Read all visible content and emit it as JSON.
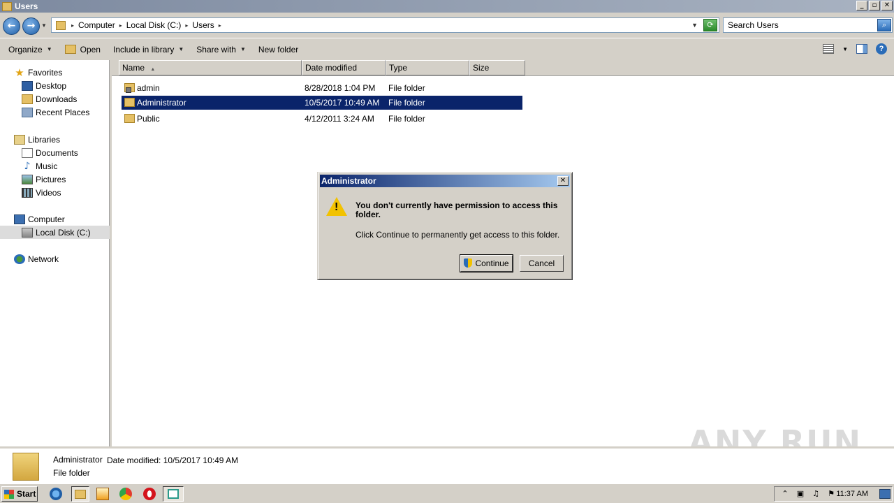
{
  "window": {
    "title": "Users"
  },
  "address": {
    "breadcrumbs": [
      "Computer",
      "Local Disk (C:)",
      "Users"
    ],
    "search_placeholder": "Search Users"
  },
  "toolbar": {
    "organize": "Organize",
    "open": "Open",
    "include_in_library": "Include in library",
    "share_with": "Share with",
    "new_folder": "New folder"
  },
  "nav": {
    "favorites": "Favorites",
    "desktop": "Desktop",
    "downloads": "Downloads",
    "recent_places": "Recent Places",
    "libraries": "Libraries",
    "documents": "Documents",
    "music": "Music",
    "pictures": "Pictures",
    "videos": "Videos",
    "computer": "Computer",
    "local_disk": "Local Disk (C:)",
    "network": "Network"
  },
  "columns": {
    "name": "Name",
    "date_modified": "Date modified",
    "type": "Type",
    "size": "Size"
  },
  "files": [
    {
      "name": "admin",
      "date": "8/28/2018 1:04 PM",
      "type": "File folder",
      "locked": true
    },
    {
      "name": "Administrator",
      "date": "10/5/2017 10:49 AM",
      "type": "File folder",
      "selected": true
    },
    {
      "name": "Public",
      "date": "4/12/2011 3:24 AM",
      "type": "File folder"
    }
  ],
  "dialog": {
    "title": "Administrator",
    "message": "You don't currently have permission to access this folder.",
    "submessage": "Click Continue to permanently get access to this folder.",
    "continue_label": "Continue",
    "cancel_label": "Cancel"
  },
  "details": {
    "name": "Administrator",
    "date_modified": "Date modified: 10/5/2017 10:49 AM",
    "type": "File folder"
  },
  "watermark": "ANY RUN",
  "taskbar": {
    "start_label": "Start",
    "clock": "11:37 AM"
  },
  "colors": {
    "selection": "#0a246a",
    "dialog_title_start": "#0a246a",
    "dialog_title_end": "#a6caf0"
  }
}
